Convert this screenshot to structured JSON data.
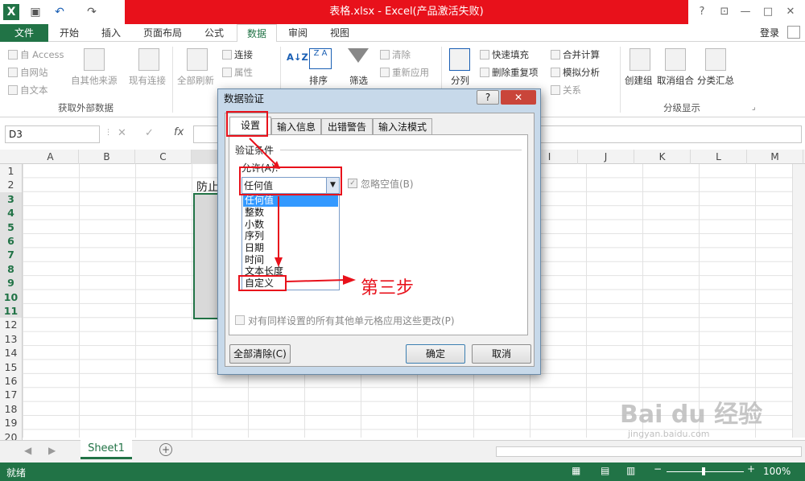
{
  "window": {
    "title": "表格.xlsx -  Excel(产品激活失败)",
    "help": "?",
    "min": "—",
    "max": "□",
    "close": "✕"
  },
  "tabs": [
    "文件",
    "开始",
    "插入",
    "页面布局",
    "公式",
    "数据",
    "审阅",
    "视图"
  ],
  "login": "登录",
  "ribbon": {
    "access": "自 Access",
    "web": "自网站",
    "text": "自文本",
    "other": "自其他来源",
    "existing": "现有连接",
    "refresh": "全部刷新",
    "connections": "连接",
    "properties": "属性",
    "group_external": "获取外部数据",
    "sort": "排序",
    "filter": "筛选",
    "clear": "清除",
    "reapply": "重新应用",
    "split": "分列",
    "flashfill": "快速填充",
    "removedup": "删除重复项",
    "consolidate": "合并计算",
    "whatif": "模拟分析",
    "relations": "关系",
    "group": "创建组",
    "ungroup": "取消组合",
    "subtotal": "分类汇总",
    "group_outline": "分级显示"
  },
  "namebox": "D3",
  "formula_icons": {
    "cancel": "✕",
    "enter": "✓",
    "fx": "fx"
  },
  "columns": [
    "A",
    "B",
    "C",
    "",
    "",
    "",
    "",
    "",
    "",
    "I",
    "J",
    "K",
    "L",
    "M"
  ],
  "rows": [
    "1",
    "2",
    "3",
    "4",
    "5",
    "6",
    "7",
    "8",
    "9",
    "10",
    "11",
    "12",
    "13",
    "14",
    "15",
    "16",
    "17",
    "18",
    "19",
    "20"
  ],
  "cell_c2": "防止",
  "sheet": "Sheet1",
  "status": {
    "ready": "就绪",
    "zoom": "100%"
  },
  "dialog": {
    "title": "数据验证",
    "tabs": [
      "设置",
      "输入信息",
      "出错警告",
      "输入法模式"
    ],
    "criteria": "验证条件",
    "allow_label": "允许(A):",
    "allow_value": "任何值",
    "ignore_blank": "忽略空值(B)",
    "options": [
      "任何值",
      "整数",
      "小数",
      "序列",
      "日期",
      "时间",
      "文本长度",
      "自定义"
    ],
    "apply_all": "对有同样设置的所有其他单元格应用这些更改(P)",
    "clear_all": "全部清除(C)",
    "ok": "确定",
    "cancel": "取消"
  },
  "annotation": "第三步",
  "watermark": {
    "brand": "Bai du 经验",
    "url": "jingyan.baidu.com"
  }
}
